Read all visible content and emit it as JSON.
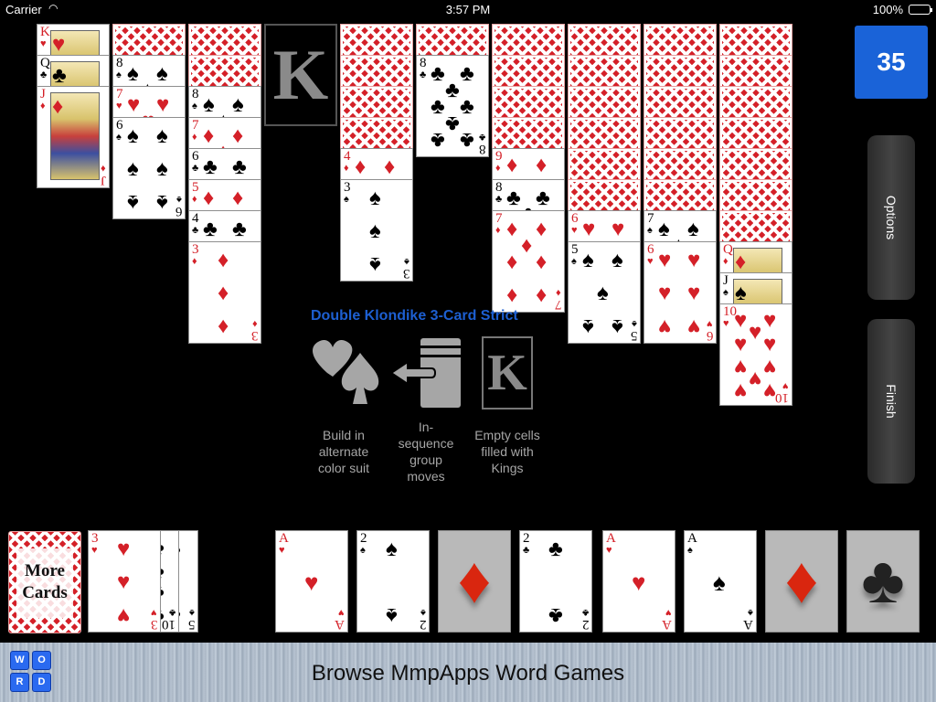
{
  "status_bar": {
    "carrier": "Carrier",
    "time": "3:57 PM",
    "battery": "100%"
  },
  "score": "35",
  "side_buttons": {
    "options": "Options",
    "finish": "Finish"
  },
  "rules": {
    "title": "Double Klondike 3-Card Strict",
    "items": [
      {
        "icon": "heart-spade-icon",
        "text": "Build in alternate color suit"
      },
      {
        "icon": "group-move-icon",
        "text": "In-sequence group moves"
      },
      {
        "icon": "king-slot-icon",
        "text": "Empty cells filled with Kings"
      }
    ]
  },
  "king_slot_label": "K",
  "tableau": [
    {
      "facedown": 0,
      "faceup": [
        "K♥",
        "Q♣",
        "J♦"
      ]
    },
    {
      "facedown": 1,
      "faceup": [
        "8♠",
        "7♥",
        "6♠"
      ]
    },
    {
      "facedown": 2,
      "faceup": [
        "8♠",
        "7♦",
        "6♣",
        "5♦",
        "4♣",
        "3♦"
      ]
    },
    {
      "facedown": 0,
      "faceup": [],
      "empty_label": "K"
    },
    {
      "facedown": 4,
      "faceup": [
        "4♦",
        "3♠"
      ]
    },
    {
      "facedown": 1,
      "faceup": [
        "8♣"
      ]
    },
    {
      "facedown": 4,
      "faceup": [
        "9♦",
        "8♣",
        "7♦"
      ]
    },
    {
      "facedown": 6,
      "faceup": [
        "6♥",
        "5♠"
      ]
    },
    {
      "facedown": 6,
      "faceup": [
        "7♠",
        "6♥"
      ]
    },
    {
      "facedown": 7,
      "faceup": [
        "Q♦",
        "J♠",
        "10♥"
      ]
    }
  ],
  "stock": {
    "label_line1": "More",
    "label_line2": "Cards"
  },
  "waste": [
    "5♠",
    "10♣",
    "3♥"
  ],
  "foundations": [
    {
      "card": "A♥"
    },
    {
      "card": "2♠"
    },
    {
      "empty_suit": "♦"
    },
    {
      "card": "2♣"
    },
    {
      "card": "A♥"
    },
    {
      "card": "A♠"
    },
    {
      "empty_suit": "♦"
    },
    {
      "empty_suit": "♣"
    }
  ],
  "banner": {
    "title": "Browse MmpApps Word Games",
    "logo_letters": [
      "W",
      "O",
      "R",
      "D"
    ]
  }
}
